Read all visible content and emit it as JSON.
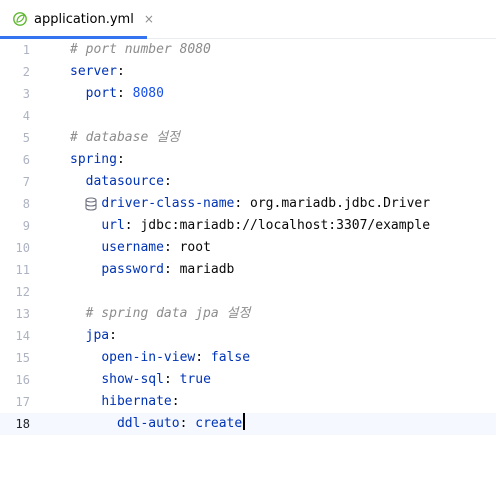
{
  "tab": {
    "filename": "application.yml",
    "close_glyph": "×",
    "icon": "spring-leaf-icon"
  },
  "colors": {
    "accent": "#3574f0",
    "comment": "#8c8c8c",
    "key": "#0033b3",
    "number": "#1750eb",
    "string": "#067d17"
  },
  "lines": [
    {
      "n": "1",
      "text": "# port number 8080"
    },
    {
      "n": "2",
      "key": "server",
      "colon": ":"
    },
    {
      "n": "3",
      "indent": "  ",
      "key": "port",
      "colon": ": ",
      "value": "8080"
    },
    {
      "n": "4"
    },
    {
      "n": "5",
      "text": "# database 설정"
    },
    {
      "n": "6",
      "key": "spring",
      "colon": ":"
    },
    {
      "n": "7",
      "indent": "  ",
      "key": "datasource",
      "colon": ":",
      "gutter_icon": "database-icon"
    },
    {
      "n": "8",
      "indent": "    ",
      "key": "driver-class-name",
      "colon": ": ",
      "value": "org.mariadb.jdbc.Driver"
    },
    {
      "n": "9",
      "indent": "    ",
      "key": "url",
      "colon": ": ",
      "value": "jdbc:mariadb://localhost:3307/example"
    },
    {
      "n": "10",
      "indent": "    ",
      "key": "username",
      "colon": ": ",
      "value": "root"
    },
    {
      "n": "11",
      "indent": "    ",
      "key": "password",
      "colon": ": ",
      "value": "mariadb"
    },
    {
      "n": "12"
    },
    {
      "n": "13",
      "indent": "  ",
      "text": "# spring data jpa 설정"
    },
    {
      "n": "14",
      "indent": "  ",
      "key": "jpa",
      "colon": ":"
    },
    {
      "n": "15",
      "indent": "    ",
      "key": "open-in-view",
      "colon": ": ",
      "value": "false"
    },
    {
      "n": "16",
      "indent": "    ",
      "key": "show-sql",
      "colon": ": ",
      "value": "true"
    },
    {
      "n": "17",
      "indent": "    ",
      "key": "hibernate",
      "colon": ":"
    },
    {
      "n": "18",
      "indent": "      ",
      "key": "ddl-auto",
      "colon": ": ",
      "value": "create"
    }
  ]
}
